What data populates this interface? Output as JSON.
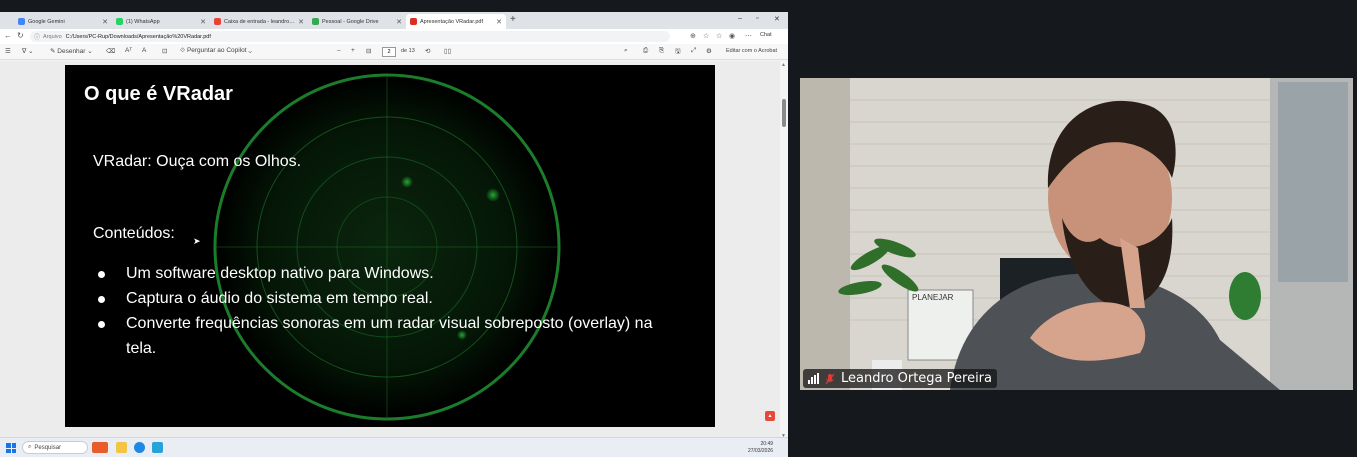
{
  "browser": {
    "tabs": [
      {
        "label": "Google Gemini",
        "color": "#4285f4",
        "active": false
      },
      {
        "label": "(1) WhatsApp",
        "color": "#25d366",
        "active": false
      },
      {
        "label": "Caixa de entrada - leandroortega@",
        "color": "#ea4335",
        "active": false
      },
      {
        "label": "Pessoal - Google Drive",
        "color": "#34a853",
        "active": false
      },
      {
        "label": "Apresentação VRadar.pdf",
        "color": "#d93025",
        "active": true
      }
    ],
    "url_prefix": "Arquivo",
    "url": "C:/Users/PC-Rup/Downloads/Apresentação%20VRadar.pdf",
    "chat_label": "Chat"
  },
  "pdf_toolbar": {
    "draw_label": "Desenhar",
    "copilot_label": "Perguntar ao Copilot",
    "page_current": "2",
    "page_total": "de 13",
    "edit_acrobat": "Editar com o Acrobat"
  },
  "slide": {
    "title": "O que é VRadar",
    "subtitle": "VRadar: Ouça com os Olhos.",
    "contents_heading": "Conteúdos:",
    "bullets": [
      "Um software desktop nativo para Windows.",
      "Captura o áudio do sistema em tempo real.",
      "Converte frequências sonoras em um radar visual sobreposto (overlay) na tela."
    ]
  },
  "taskbar": {
    "search_placeholder": "Pesquisar",
    "time": "20:49",
    "date": "27/03/2026"
  },
  "participant": {
    "name": "Leandro Ortega Pereira",
    "muted": true,
    "whiteboard_text": "PLANEJAR"
  },
  "colors": {
    "radar_green": "#1f8a2e",
    "muted_red": "#e53935"
  }
}
